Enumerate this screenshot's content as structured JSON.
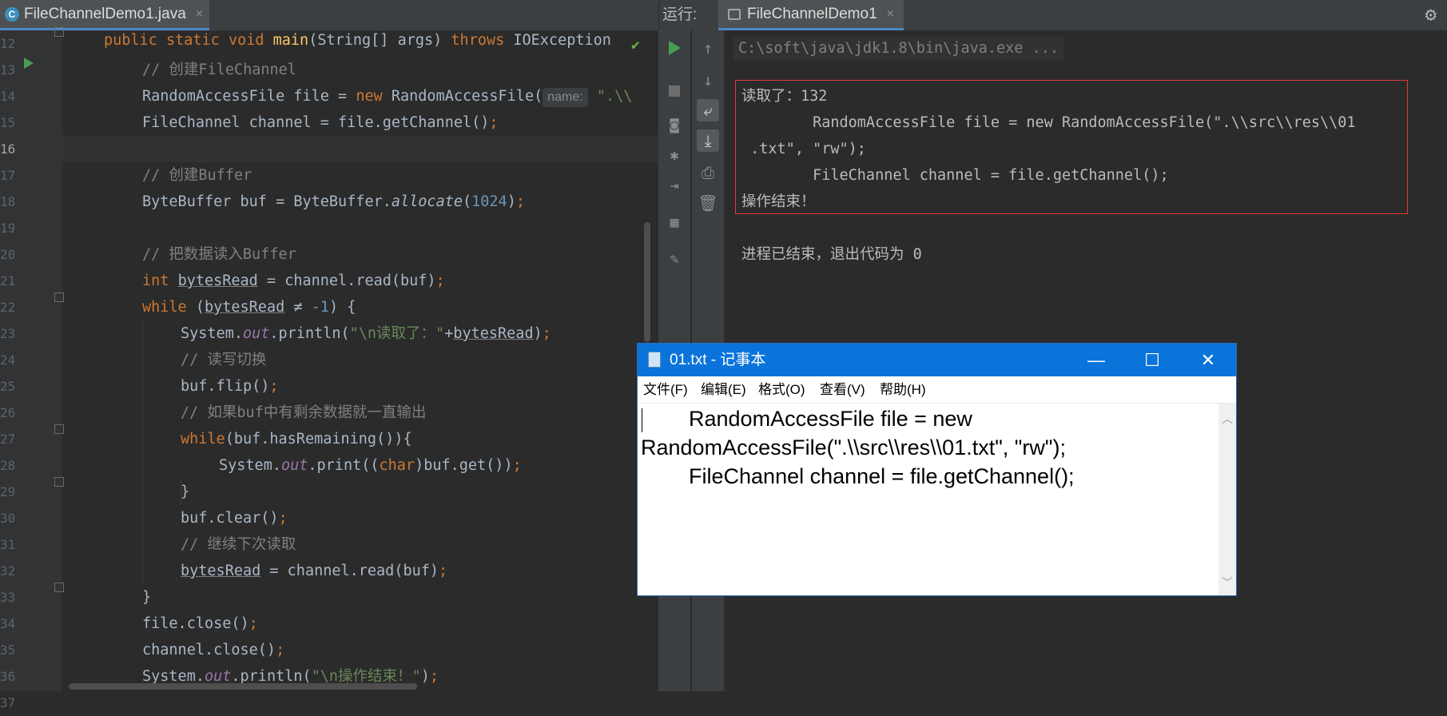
{
  "editor": {
    "tab": {
      "icon": "java-class-icon",
      "title": "FileChannelDemo1.java",
      "close": "×"
    },
    "line_numbers": [
      "12",
      "13",
      "14",
      "15",
      "16",
      "17",
      "18",
      "19",
      "20",
      "21",
      "22",
      "23",
      "24",
      "25",
      "26",
      "27",
      "28",
      "29",
      "30",
      "31",
      "32",
      "33",
      "34",
      "35",
      "36",
      "37"
    ],
    "code": {
      "l12": {
        "kw1": "public",
        "kw2": "static",
        "kw3": "void",
        "name": "main",
        "params": "(String[] args)",
        "kw4": "throws",
        "ex": "IOException"
      },
      "l13": "// 创建FileChannel",
      "l14": {
        "a": "RandomAccessFile file = ",
        "kw": "new",
        "b": "RandomAccessFile(",
        "hint": "name:",
        "str": "\".\\\\"
      },
      "l15": {
        "a": "FileChannel channel = file.getChannel()",
        "semi": ";"
      },
      "l17": "// 创建Buffer",
      "l18": {
        "a": "ByteBuffer buf = ByteBuffer.",
        "method": "allocate",
        "p1": "(",
        "num": "1024",
        "p2": ")",
        "semi": ";"
      },
      "l20": "// 把数据读入Buffer",
      "l21": {
        "kw": "int",
        "var": "bytesRead",
        "b": " = channel.read(buf)",
        "semi": ";"
      },
      "l22": {
        "kw": "while",
        "a": " (",
        "var": "bytesRead",
        "op": " ≠ ",
        "num": "-1",
        "b": ") {"
      },
      "l23": {
        "a": "System.",
        "fld": "out",
        "b": ".println(",
        "str1": "\"\\n读取了：\"",
        "c": "+",
        "var": "bytesRead",
        "d": ")",
        "semi": ";"
      },
      "l24": "// 读写切换",
      "l25": {
        "a": "buf.flip()",
        "semi": ";"
      },
      "l26": "// 如果buf中有剩余数据就一直输出",
      "l27": {
        "kw": "while",
        "a": "(buf.hasRemaining()){"
      },
      "l28": {
        "a": "System.",
        "fld": "out",
        "b": ".print((",
        "kw": "char",
        "c": ")buf.get())",
        "semi": ";"
      },
      "l29": "}",
      "l30": {
        "a": "buf.clear()",
        "semi": ";"
      },
      "l31": "// 继续下次读取",
      "l32": {
        "var": "bytesRead",
        "a": " = channel.read(buf)",
        "semi": ";"
      },
      "l33": "}",
      "l34": {
        "a": "file.close()",
        "semi": ";"
      },
      "l35": {
        "a": "channel.close()",
        "semi": ";"
      },
      "l36": {
        "a": "System.",
        "fld": "out",
        "b": ".println(",
        "str1": "\"\\n操作结束！\"",
        "c": ")",
        "semi": ";"
      },
      "l37": "}"
    }
  },
  "run_panel": {
    "label": "运行:",
    "tab": {
      "icon": "console-icon",
      "title": "FileChannelDemo1",
      "close": "×"
    },
    "settings_icon": "gear-icon",
    "toolbar_left": [
      "rerun-icon",
      "stop-icon",
      "screenshot-icon",
      "debug-bug-icon",
      "exit-icon",
      "layout-icon",
      "pin-icon"
    ],
    "toolbar_right": [
      "up-arrow-icon",
      "down-arrow-icon",
      "soft-wrap-icon",
      "scroll-to-end-icon",
      "print-icon",
      "trash-icon"
    ],
    "console": {
      "command": "C:\\soft\\java\\jdk1.8\\bin\\java.exe ...",
      "lines": [
        "读取了：132",
        "        RandomAccessFile file = new RandomAccessFile(\".\\\\src\\\\res\\\\01",
        " .txt\", \"rw\");",
        "        FileChannel channel = file.getChannel();",
        "操作结束！"
      ],
      "exit_message": "进程已结束，退出代码为 0"
    }
  },
  "notepad": {
    "title": "01.txt - 记事本",
    "menu": [
      "文件(F)",
      "编辑(E)",
      "格式(O)",
      "查看(V)",
      "帮助(H)"
    ],
    "content": [
      "        RandomAccessFile file = new",
      "RandomAccessFile(\".\\\\src\\\\res\\\\01.txt\", \"rw\");",
      "        FileChannel channel = file.getChannel();"
    ],
    "controls": {
      "minimize": "—",
      "maximize": "☐",
      "close": "✕"
    }
  },
  "colors": {
    "keyword": "#cc7832",
    "comment": "#808080",
    "string": "#6a8759",
    "number": "#6897bb",
    "field": "#9876aa",
    "highlight_border": "#e03a3a",
    "notepad_titlebar": "#0a74da"
  }
}
